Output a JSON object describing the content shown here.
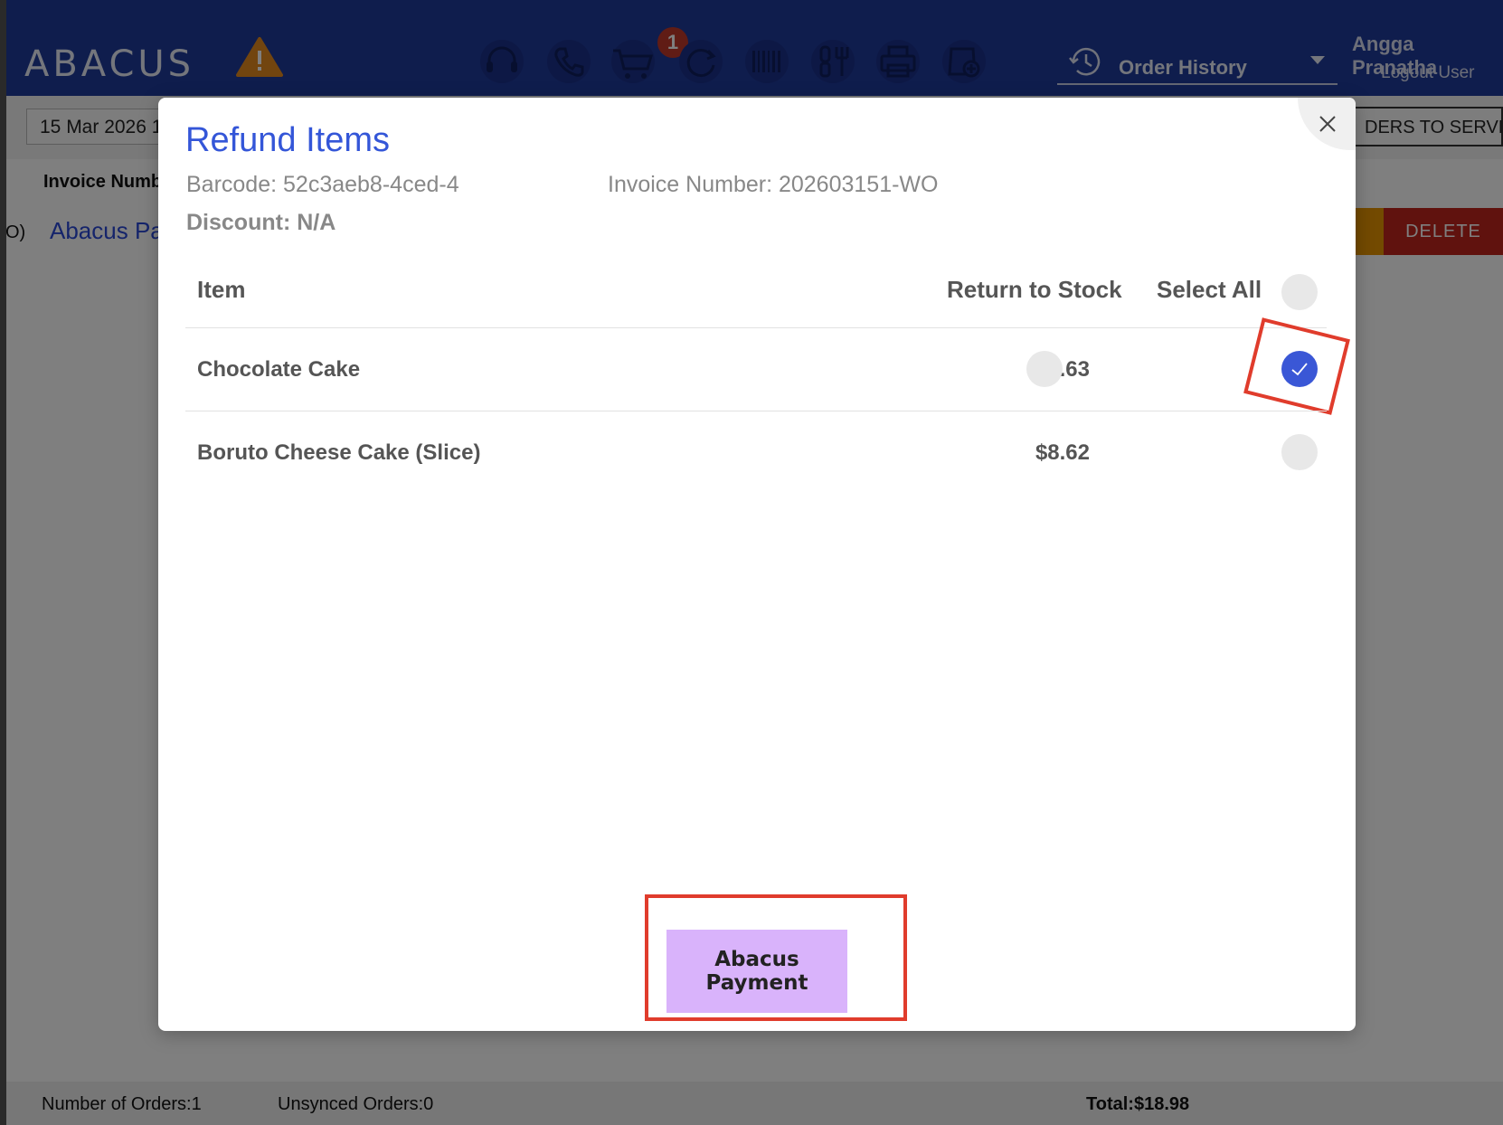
{
  "app": {
    "logo_text": "ABACUS",
    "cart_count": "1",
    "order_history_label": "Order History",
    "user_name": "Angga Pranatha",
    "logout_label": "Logout User",
    "date_value": "15 Mar 2026 1",
    "sync_label": "DERS TO SERVER",
    "list_column_header": "Invoice Numb",
    "row_prefix": "O)",
    "row_name_partial": "Abacus Pa",
    "delete_label": "DELETE",
    "footer": {
      "orders": "Number of Orders:1",
      "unsynced": "Unsynced Orders:0",
      "total": "Total:$18.98"
    },
    "colors": {
      "topbar": "#1f3a9a",
      "delete": "#c0241d",
      "accent": "#3a57d6",
      "pay_button": "#d9b3fb",
      "annotation": "#e03c2c"
    }
  },
  "modal": {
    "title": "Refund Items",
    "barcode": "Barcode: 52c3aeb8-4ced-4",
    "invoice_number": "Invoice Number: 202603151-WO",
    "discount": "Discount: N/A",
    "headers": {
      "item": "Item",
      "return_to_stock": "Return to Stock",
      "select_all": "Select All"
    },
    "items": [
      {
        "name": "Chocolate Cake",
        "price": "$8.63",
        "return_to_stock": false,
        "selected": true
      },
      {
        "name": "Boruto Cheese Cake (Slice)",
        "price": "$8.62",
        "selected": false
      }
    ],
    "pay_button_label": "Abacus Payment"
  }
}
